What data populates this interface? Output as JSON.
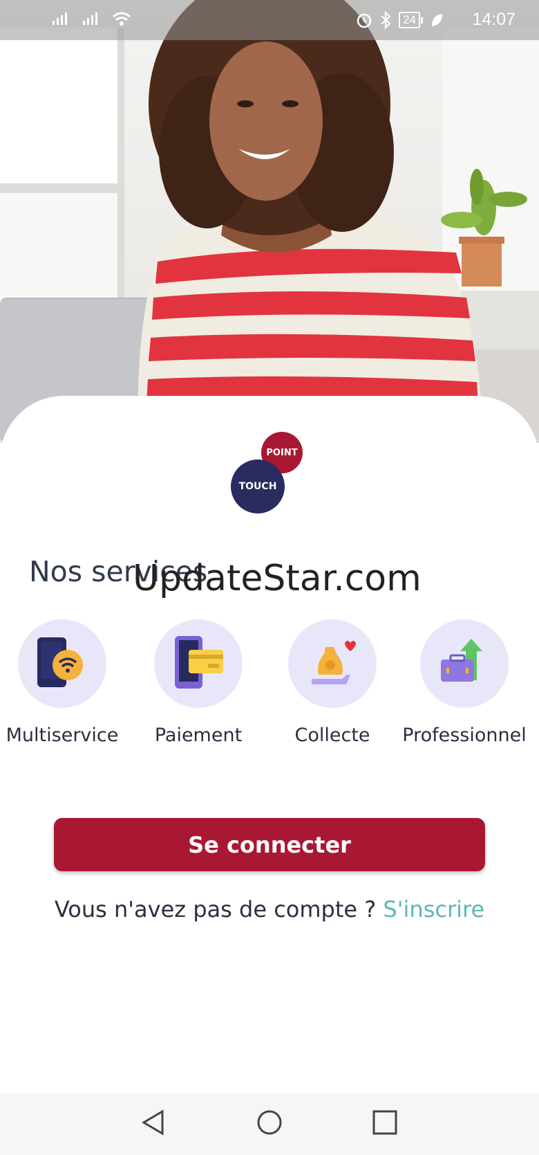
{
  "status_bar": {
    "time": "14:07",
    "battery": "24",
    "icons": [
      "signal-icon",
      "signal-icon",
      "wifi-icon",
      "alarm-icon",
      "bluetooth-icon",
      "battery-icon",
      "leaf-icon"
    ]
  },
  "logo": {
    "top": "POINT",
    "bottom": "TOUCH"
  },
  "section_title": "Nos services",
  "watermark": "UpdateStar.com",
  "services": [
    {
      "label": "Multiservice",
      "icon": "phone-wifi-icon"
    },
    {
      "label": "Paiement",
      "icon": "phone-card-icon"
    },
    {
      "label": "Collecte",
      "icon": "money-bag-icon"
    },
    {
      "label": "Professionnel",
      "icon": "briefcase-growth-icon"
    }
  ],
  "connect_button": "Se connecter",
  "signup": {
    "prompt": "Vous n'avez pas de compte ? ",
    "link": "S'inscrire"
  },
  "colors": {
    "brand_red": "#a91832",
    "brand_navy": "#2a2b5e",
    "link_teal": "#5fb7b3",
    "service_circle": "#e8e7fa"
  }
}
